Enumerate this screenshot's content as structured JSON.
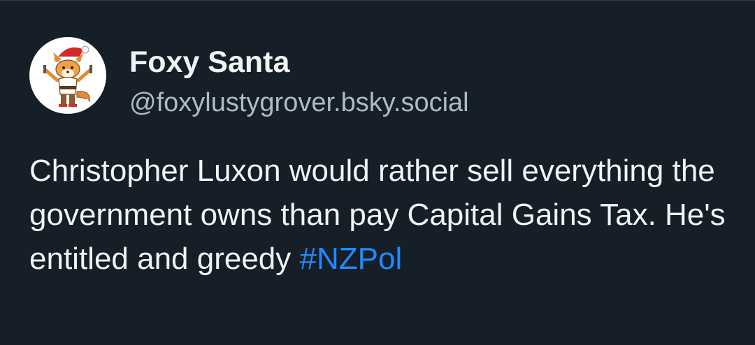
{
  "post": {
    "author": {
      "display_name": "Foxy Santa",
      "handle": "@foxylustygrover.bsky.social",
      "avatar_icon": "fox-santa-avatar"
    },
    "text": "Christopher Luxon would rather sell everything the government owns than pay Capital Gains Tax. He's entitled and greedy ",
    "hashtag": "#NZPol"
  },
  "colors": {
    "background": "#161e27",
    "text": "#f1f3f5",
    "handle": "#aebbc9",
    "link": "#208bfe"
  }
}
